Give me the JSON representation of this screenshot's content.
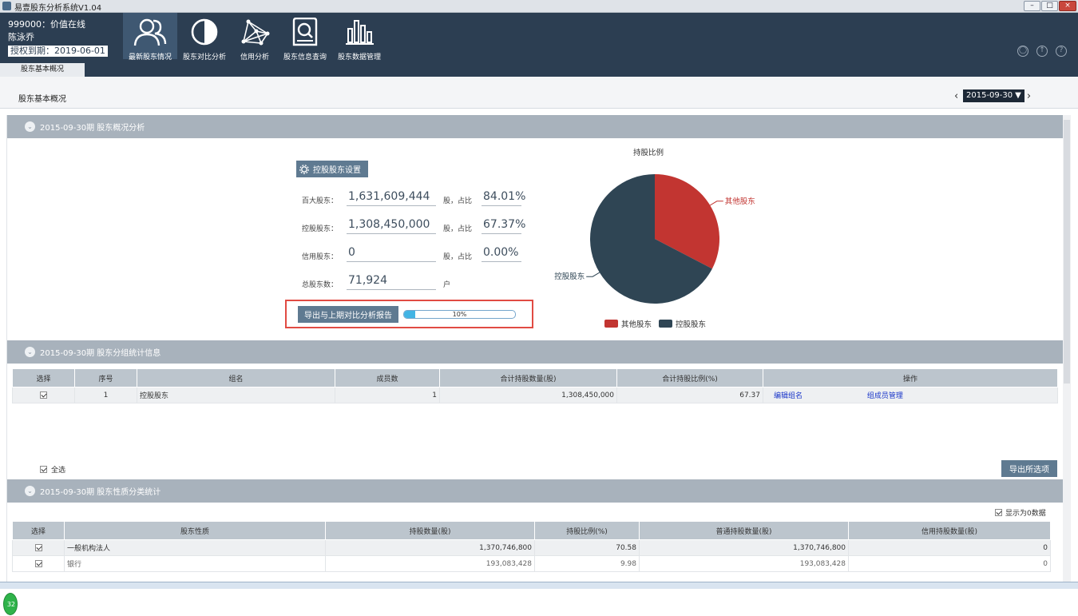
{
  "window": {
    "title": "易壹股东分析系统V1.04",
    "minimize": "–",
    "restore": "□",
    "close": "×"
  },
  "user": {
    "line1": "999000：价值在线",
    "name": "陈泳乔",
    "auth": "授权到期：2019-06-01"
  },
  "nav": [
    {
      "label": "最新股东情况",
      "icon": "users-icon",
      "active": true
    },
    {
      "label": "股东对比分析",
      "icon": "contrast-icon",
      "active": false
    },
    {
      "label": "信用分析",
      "icon": "network-icon",
      "active": false
    },
    {
      "label": "股东信息查询",
      "icon": "search-doc-icon",
      "active": false
    },
    {
      "label": "股东数据管理",
      "icon": "bar-chart-icon",
      "active": false
    }
  ],
  "header_icons": [
    "user-circle-icon",
    "upload-icon",
    "help-icon"
  ],
  "tab": {
    "label": "股东基本概况"
  },
  "subheader": {
    "title": "股东基本概况",
    "date": "2015-09-30"
  },
  "section1": {
    "title": "2015-09-30期 股东概况分析",
    "settings_button": "控股股东设置",
    "stats": [
      {
        "label": "百大股东：",
        "value": "1,631,609,444",
        "unit": "股，占比",
        "pct": "84.01%"
      },
      {
        "label": "控股股东：",
        "value": "1,308,450,000",
        "unit": "股，占比",
        "pct": "67.37%"
      },
      {
        "label": "信用股东：",
        "value": "0",
        "unit": "股，占比",
        "pct": "0.00%"
      },
      {
        "label": "总股东数：",
        "value": "71,924",
        "unit": "户",
        "pct": null
      }
    ],
    "export_button": "导出与上期对比分析报告",
    "progress": {
      "percent": 10,
      "label": "10%"
    }
  },
  "chart_data": {
    "type": "pie",
    "title": "持股比例",
    "labels": [
      "其他股东",
      "控股股东"
    ],
    "values": [
      32.63,
      67.37
    ],
    "colors": [
      "#c23531",
      "#2f4554"
    ],
    "legend": "bottom"
  },
  "section2": {
    "title": "2015-09-30期 股东分组统计信息",
    "headers": [
      "选择",
      "序号",
      "组名",
      "成员数",
      "合计持股数量(股)",
      "合计持股比例(%)",
      "操作"
    ],
    "rows": [
      {
        "index": "1",
        "name": "控股股东",
        "members": "1",
        "shares": "1,308,450,000",
        "ratio": "67.37",
        "op1": "编辑组名",
        "op2": "组成员管理"
      }
    ],
    "select_all": "全选",
    "export_selected": "导出所选项"
  },
  "section3": {
    "title": "2015-09-30期 股东性质分类统计",
    "show_zero": "显示为0数据",
    "headers": [
      "选择",
      "股东性质",
      "持股数量(股)",
      "持股比例(%)",
      "普通持股数量(股)",
      "信用持股数量(股)"
    ],
    "rows": [
      {
        "type": "一般机构法人",
        "shares": "1,370,746,800",
        "ratio": "70.58",
        "normal": "1,370,746,800",
        "credit": "0"
      },
      {
        "type": "银行",
        "shares": "193,083,428",
        "ratio": "9.98",
        "normal": "193,083,428",
        "credit": "0"
      }
    ]
  },
  "badge": "32",
  "accent": "#5f7a91"
}
